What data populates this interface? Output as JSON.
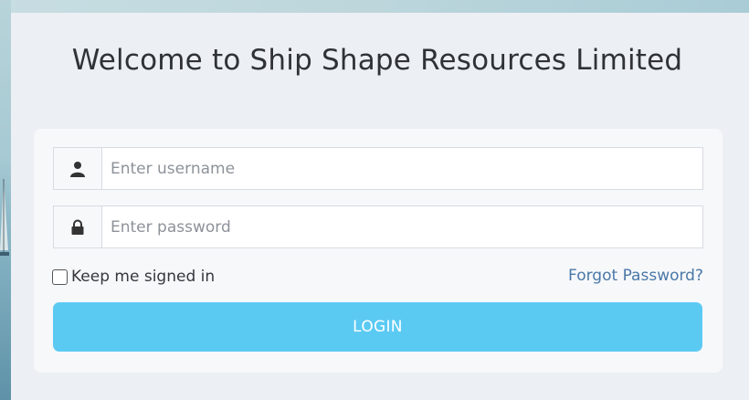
{
  "page": {
    "title": "Welcome to Ship Shape Resources Limited"
  },
  "login_form": {
    "username": {
      "placeholder": "Enter username",
      "value": "",
      "icon": "user-icon"
    },
    "password": {
      "placeholder": "Enter password",
      "value": "",
      "icon": "lock-icon"
    },
    "remember_label": "Keep me signed in",
    "remember_checked": false,
    "forgot_label": "Forgot Password?",
    "submit_label": "LOGIN"
  },
  "colors": {
    "button": "#5bcaf3",
    "link": "#4a78a8",
    "panel": "#eceff3",
    "card": "#f7f8fa"
  }
}
